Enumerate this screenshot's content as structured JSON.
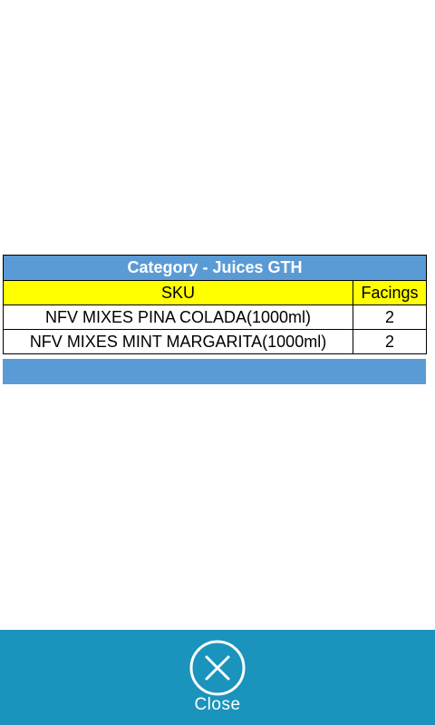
{
  "table": {
    "title": "Category - Juices GTH",
    "columns": [
      "SKU",
      "Facings"
    ],
    "rows": [
      {
        "sku": "NFV MIXES PINA COLADA(1000ml)",
        "facings": "2"
      },
      {
        "sku": "NFV MIXES MINT MARGARITA(1000ml)",
        "facings": "2"
      }
    ]
  },
  "footer": {
    "close_label": "Close",
    "close_icon": "close-circle-icon"
  },
  "colors": {
    "title_bg": "#5b9bd5",
    "header_bg": "#ffff00",
    "bottom_bar_bg": "#1a94bd",
    "text_on_accent": "#ffffff"
  }
}
